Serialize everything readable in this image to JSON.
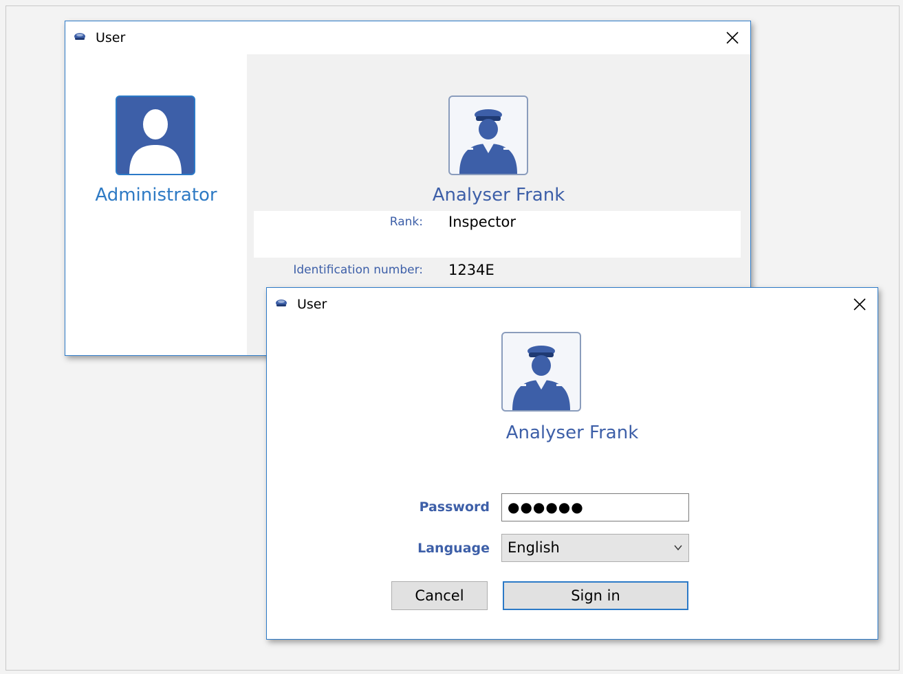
{
  "colors": {
    "accent": "#2b79c7",
    "officer_blue": "#3d5fa8",
    "admin_name": "#2e7ac4"
  },
  "window_back": {
    "title": "User",
    "icon": "police-cap-icon",
    "close_icon": "close-icon",
    "admin": {
      "name": "Administrator",
      "icon": "user-silhouette-icon"
    },
    "profile": {
      "name": "Analyser Frank",
      "icon": "police-officer-icon",
      "rank_label": "Rank:",
      "rank_value": "Inspector",
      "id_label": "Identification number:",
      "id_value": "1234E"
    }
  },
  "window_front": {
    "title": "User",
    "icon": "police-cap-icon",
    "close_icon": "close-icon",
    "profile": {
      "name": "Analyser Frank",
      "icon": "police-officer-icon"
    },
    "password": {
      "label": "Password",
      "value": "●●●●●●"
    },
    "language": {
      "label": "Language",
      "selected": "English"
    },
    "cancel_label": "Cancel",
    "signin_label": "Sign in"
  }
}
